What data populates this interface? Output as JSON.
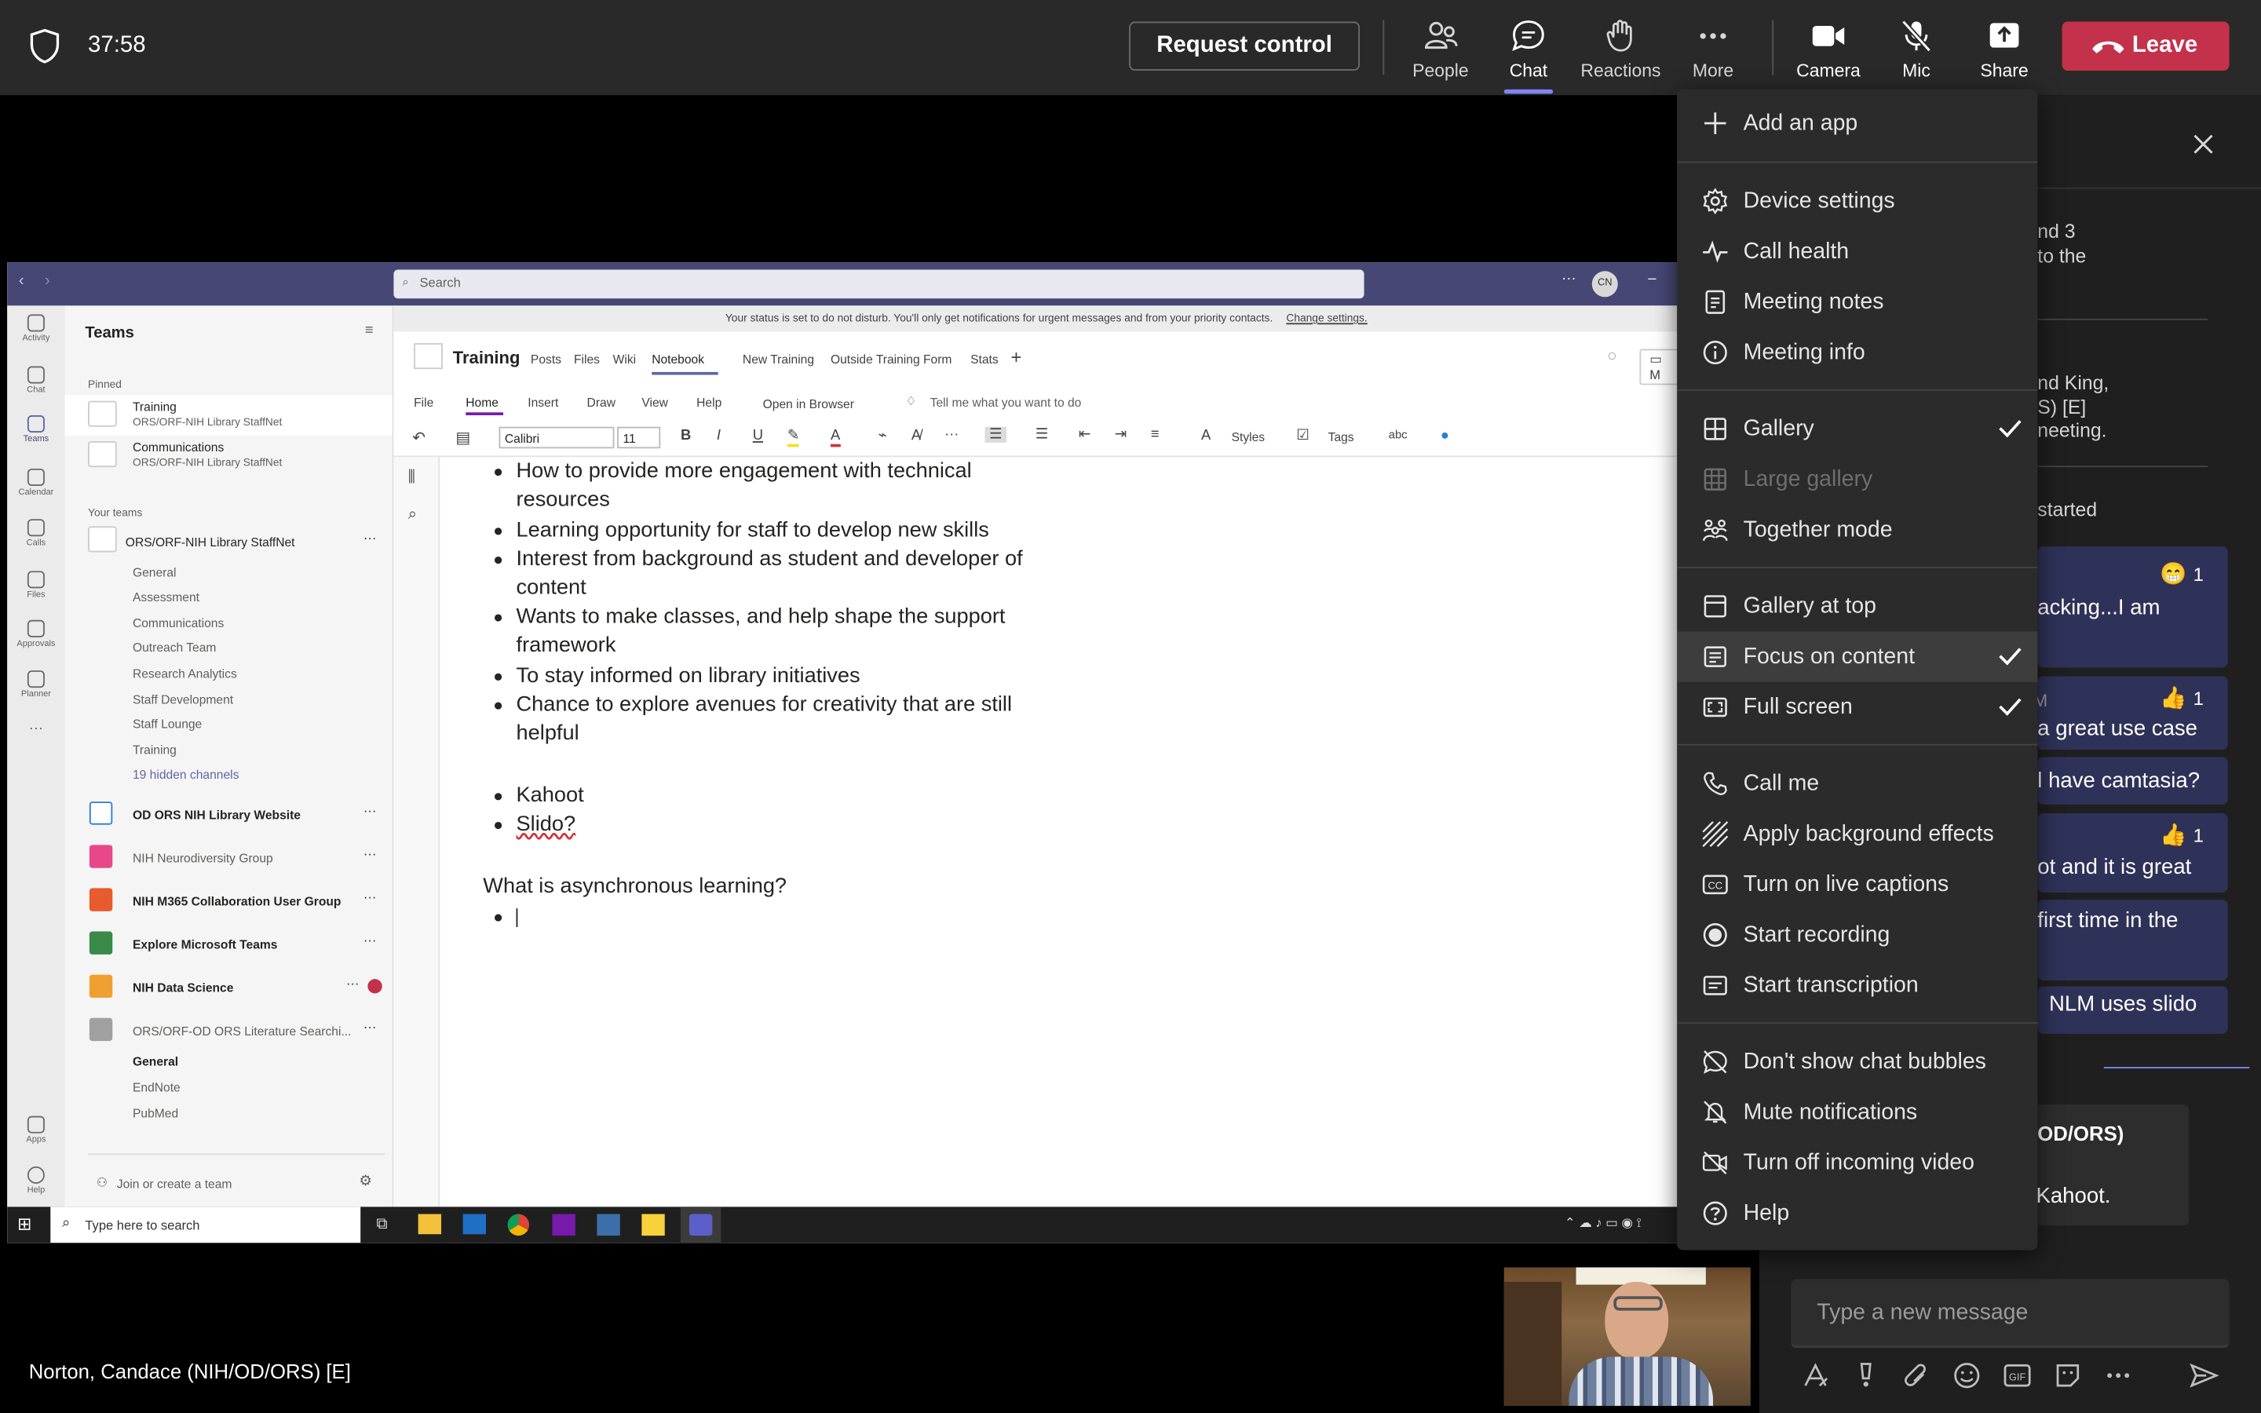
{
  "topbar": {
    "timer": "37:58",
    "request_control": "Request control",
    "buttons": [
      {
        "label": "People",
        "icon": "people-icon"
      },
      {
        "label": "Chat",
        "icon": "chat-icon"
      },
      {
        "label": "Reactions",
        "icon": "reactions-icon"
      },
      {
        "label": "More",
        "icon": "more-icon"
      },
      {
        "label": "Camera",
        "icon": "camera-icon"
      },
      {
        "label": "Mic",
        "icon": "mic-off-icon"
      },
      {
        "label": "Share",
        "icon": "share-icon"
      }
    ],
    "leave": "Leave",
    "accent": "#c4314b"
  },
  "menu": {
    "items": [
      {
        "label": "Add an app",
        "icon": "plus-icon"
      },
      {
        "label": "Device settings",
        "icon": "gear-icon"
      },
      {
        "label": "Call health",
        "icon": "pulse-icon"
      },
      {
        "label": "Meeting notes",
        "icon": "notes-icon"
      },
      {
        "label": "Meeting info",
        "icon": "info-icon"
      },
      {
        "label": "Gallery",
        "icon": "grid-icon",
        "checked": true
      },
      {
        "label": "Large gallery",
        "icon": "large-grid-icon",
        "disabled": true
      },
      {
        "label": "Together mode",
        "icon": "together-icon"
      },
      {
        "label": "Gallery at top",
        "icon": "gallery-top-icon"
      },
      {
        "label": "Focus on content",
        "icon": "focus-icon",
        "checked": true,
        "highlighted": true
      },
      {
        "label": "Full screen",
        "icon": "fullscreen-icon",
        "checked": true
      },
      {
        "label": "Call me",
        "icon": "phone-icon"
      },
      {
        "label": "Apply background effects",
        "icon": "background-icon"
      },
      {
        "label": "Turn on live captions",
        "icon": "cc-icon"
      },
      {
        "label": "Start recording",
        "icon": "record-icon"
      },
      {
        "label": "Start transcription",
        "icon": "transcript-icon"
      },
      {
        "label": "Don't show chat bubbles",
        "icon": "no-bubbles-icon"
      },
      {
        "label": "Mute notifications",
        "icon": "bell-off-icon"
      },
      {
        "label": "Turn off incoming video",
        "icon": "video-off-icon"
      },
      {
        "label": "Help",
        "icon": "help-icon"
      }
    ]
  },
  "chat": {
    "fragments": [
      "nd 3",
      "to the",
      "nd King,",
      "S) [E]",
      "neeting.",
      "started",
      "acking...I am",
      "a great use case",
      "l have camtasia?",
      "ot and it is great",
      "first time in the",
      "NLM uses slido",
      "OD/ORS)",
      "Kahoot.",
      "M"
    ],
    "reaction1": "1",
    "reaction2": "1",
    "reaction3": "1",
    "placeholder": "Type a new message"
  },
  "share": {
    "search": "Search",
    "avatar": "CN",
    "status_bar": "Your status is set to do not disturb. You'll only get notifications for urgent messages and from your priority contacts.",
    "status_link": "Change settings.",
    "rail": [
      "Activity",
      "Chat",
      "Teams",
      "Calendar",
      "Calls",
      "Files",
      "Approvals",
      "Planner",
      "Apps",
      "Help"
    ],
    "teams_title": "Teams",
    "pinned": "Pinned",
    "pinned_items": [
      {
        "name": "Training",
        "sub": "ORS/ORF-NIH Library StaffNet"
      },
      {
        "name": "Communications",
        "sub": "ORS/ORF-NIH Library StaffNet"
      }
    ],
    "your_teams": "Your teams",
    "team1": "ORS/ORF-NIH Library StaffNet",
    "channels": [
      "General",
      "Assessment",
      "Communications",
      "Outreach Team",
      "Research Analytics",
      "Staff Development",
      "Staff Lounge",
      "Training"
    ],
    "hidden": "19 hidden channels",
    "other_teams": [
      "OD ORS NIH Library Website",
      "NIH Neurodiversity Group",
      "NIH M365 Collaboration User Group",
      "Explore Microsoft Teams",
      "NIH Data Science",
      "ORS/ORF-OD ORS Literature Searchi..."
    ],
    "lit_channels": [
      "General",
      "EndNote",
      "PubMed"
    ],
    "join": "Join or create a team",
    "note_title": "Training",
    "note_tabs": [
      "Posts",
      "Files",
      "Wiki",
      "Notebook",
      "New Training",
      "Outside Training Form",
      "Stats"
    ],
    "ribbon_tabs": [
      "File",
      "Home",
      "Insert",
      "Draw",
      "View",
      "Help",
      "Open in Browser",
      "Tell me what you want to do"
    ],
    "font": "Calibri",
    "font_size": "11",
    "styles": "Styles",
    "tags": "Tags",
    "bullets1": [
      "How to provide more engagement with technical",
      "resources",
      "Learning opportunity for staff to develop new skills",
      "Interest from background as student and developer of",
      "content",
      "Wants to make classes, and help shape the support",
      "framework",
      "To stay informed on library initiatives",
      "Chance to explore avenues for creativity that are still",
      "helpful"
    ],
    "bullets2": [
      "Kahoot",
      "Slido?"
    ],
    "question": "What is asynchronous learning?",
    "taskbar_search": "Type here to search"
  },
  "video": {
    "name": "Norton, Candace (NIH/OD/ORS) [E]"
  }
}
